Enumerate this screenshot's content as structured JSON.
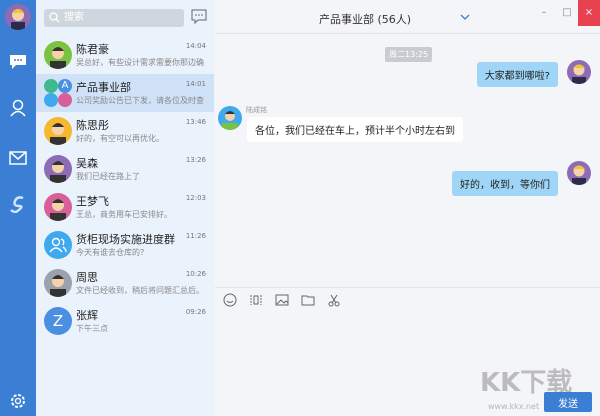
{
  "search": {
    "placeholder": "搜索"
  },
  "conversations": [
    {
      "name": "陈君豪",
      "preview": "吴总好，有些设计需求需要你那边确",
      "time": "14:04",
      "color": "#7cc242"
    },
    {
      "name": "产品事业部",
      "preview": "公司奖励公告已下发，请各位及时查",
      "time": "14:01",
      "color": "#4a90e2",
      "group_letter": "A"
    },
    {
      "name": "陈思彤",
      "preview": "好的，有空可以再优化。",
      "time": "13:46",
      "color": "#f5b82e"
    },
    {
      "name": "吴森",
      "preview": "我们已经在路上了",
      "time": "13:26",
      "color": "#8e6bb5"
    },
    {
      "name": "王梦飞",
      "preview": "王总，商务用车已安排好。",
      "time": "12:03",
      "color": "#d85f9a"
    },
    {
      "name": "货柜现场实施进度群",
      "preview": "今天有谁去仓库的?",
      "time": "11:26",
      "color": "#3fa9f0"
    },
    {
      "name": "周思",
      "preview": "文件已经收到，稍后将问题汇总后。",
      "time": "10:26",
      "color": "#9aa3ad"
    },
    {
      "name": "张辉",
      "preview": "下午三点",
      "time": "09:26",
      "color": "#4a8fe2",
      "letter": "Z"
    }
  ],
  "chat": {
    "title": "产品事业部 (56人)",
    "timestamp": "周二13:25",
    "messages": [
      {
        "from": "me",
        "text": "大家都到哪啦?"
      },
      {
        "from": "陆成铭",
        "text": "各位，我们已经在车上，预计半个小时左右到"
      },
      {
        "from": "me",
        "text": "好的，收到，等你们"
      }
    ],
    "send_label": "发送"
  },
  "window": {
    "minimize": "–",
    "maximize": "□",
    "close": "×"
  },
  "watermark": {
    "logo": "KK下载",
    "url": "www.kkx.net"
  },
  "colors": {
    "accent": "#3b7fd4",
    "bubble_me": "#9fd5f7",
    "close": "#e8414f"
  }
}
